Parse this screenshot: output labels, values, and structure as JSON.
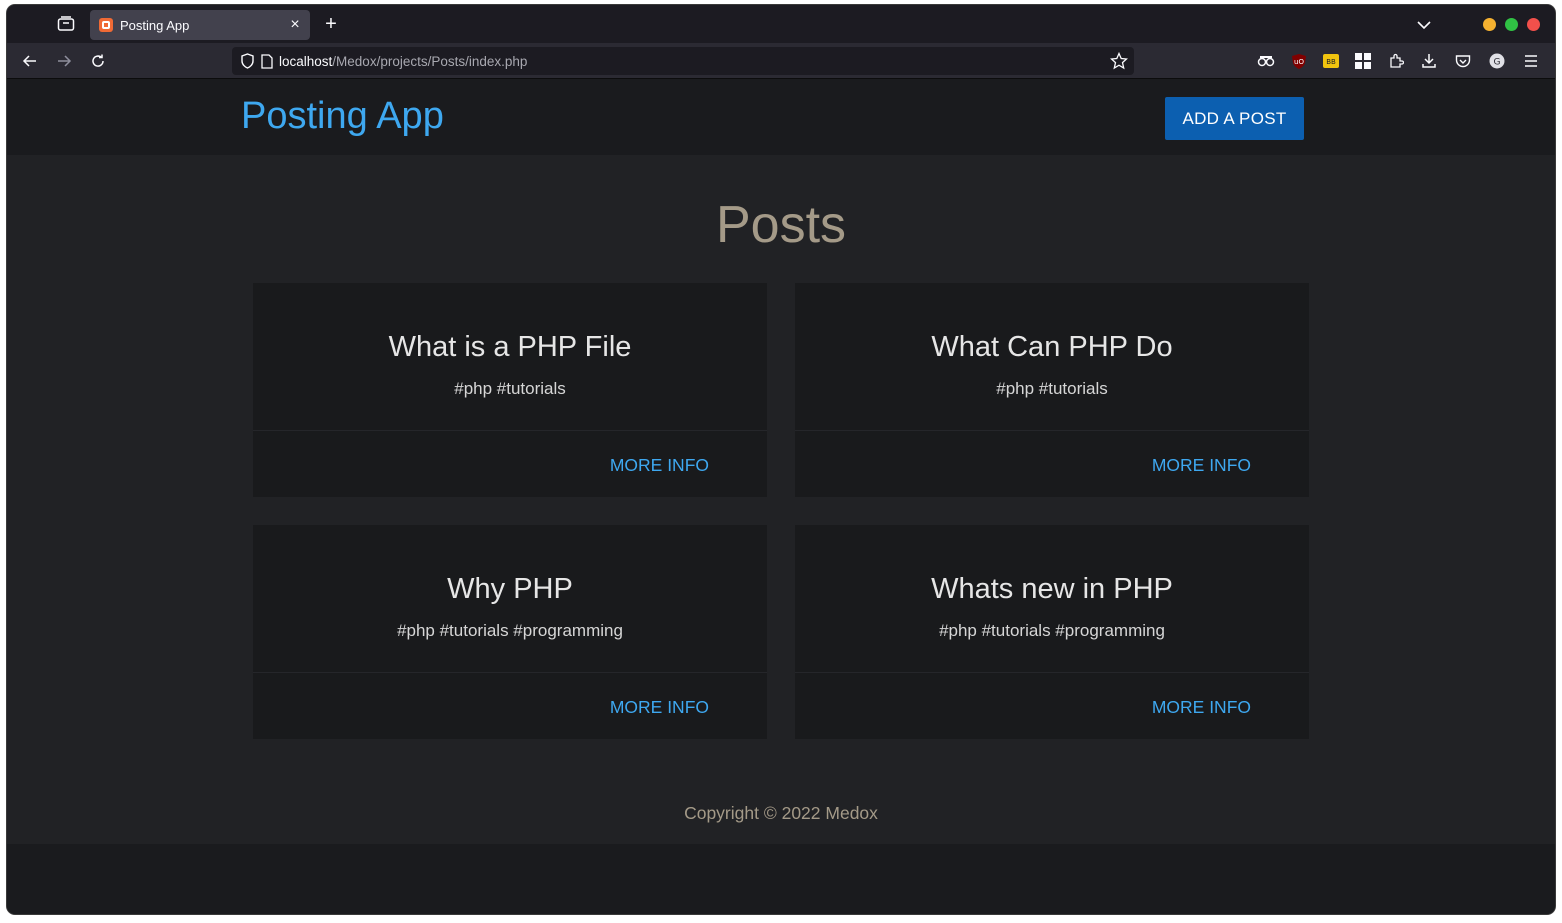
{
  "browser": {
    "tab": {
      "title": "Posting App",
      "close": "×"
    },
    "new_tab": "+",
    "url": {
      "host": "localhost",
      "path": "/Medox/projects/Posts/index.php"
    },
    "traffic_colors": {
      "minimize": "#f5b130",
      "maximize": "#30c144",
      "close": "#f2504b"
    }
  },
  "header": {
    "brand": "Posting App",
    "add_button": "ADD A POST"
  },
  "main": {
    "title": "Posts",
    "posts": [
      {
        "title": "What is a PHP File",
        "tags": "#php #tutorials",
        "action": "MORE INFO"
      },
      {
        "title": "What Can PHP Do",
        "tags": "#php #tutorials",
        "action": "MORE INFO"
      },
      {
        "title": "Why PHP",
        "tags": "#php #tutorials #programming",
        "action": "MORE INFO"
      },
      {
        "title": "Whats new in PHP",
        "tags": "#php #tutorials #programming",
        "action": "MORE INFO"
      }
    ]
  },
  "footer": {
    "copyright": "Copyright © 2022 Medox"
  },
  "colors": {
    "accent": "#3ea8f0",
    "button": "#0c5fb0",
    "heading": "#a49a88"
  }
}
